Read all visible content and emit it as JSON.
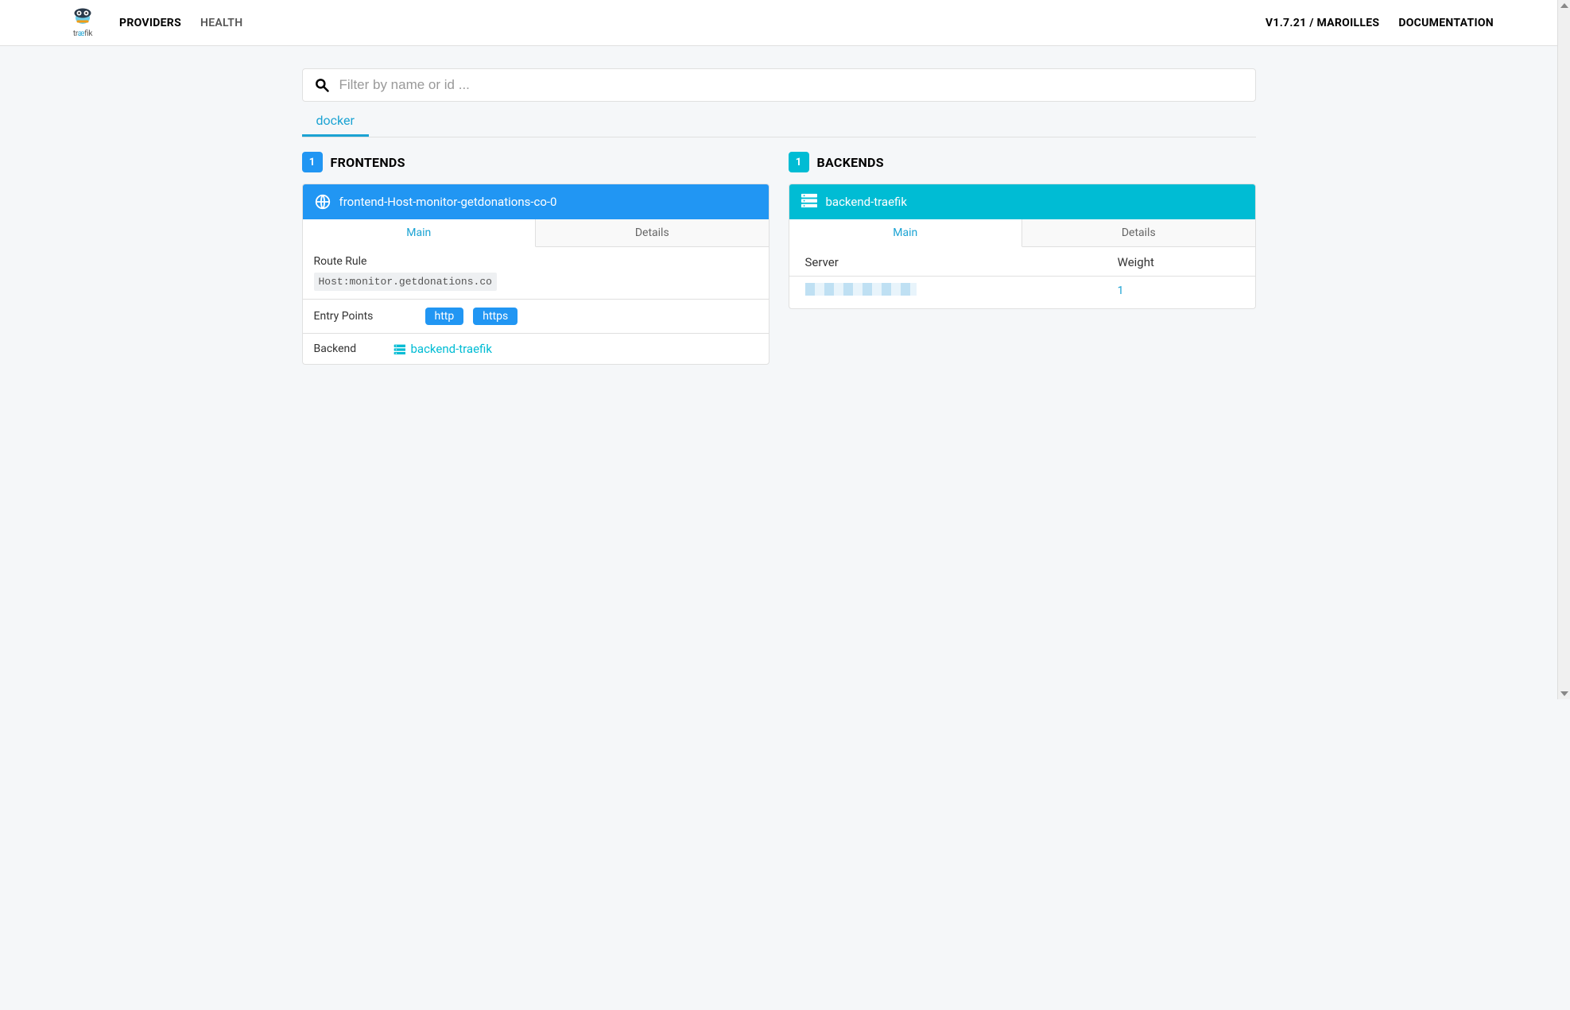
{
  "nav": {
    "logo_text_left": "tr",
    "logo_text_mid": "æ",
    "logo_text_right": "fik",
    "items": [
      "PROVIDERS",
      "HEALTH"
    ],
    "active_index": 0,
    "right": {
      "version": "V1.7.21 / MAROILLES",
      "docs": "DOCUMENTATION"
    }
  },
  "search": {
    "placeholder": "Filter by name or id ..."
  },
  "provider_tabs": {
    "items": [
      "docker"
    ],
    "active_index": 0
  },
  "frontends": {
    "title": "FRONTENDS",
    "count": "1",
    "items": [
      {
        "name": "frontend-Host-monitor-getdonations-co-0",
        "tabs": {
          "items": [
            "Main",
            "Details"
          ],
          "active_index": 0
        },
        "route_rule_label": "Route Rule",
        "route_rule_value": "Host:monitor.getdonations.co",
        "entry_points_label": "Entry Points",
        "entry_points": [
          "http",
          "https"
        ],
        "backend_label": "Backend",
        "backend_link": "backend-traefik"
      }
    ]
  },
  "backends": {
    "title": "BACKENDS",
    "count": "1",
    "items": [
      {
        "name": "backend-traefik",
        "tabs": {
          "items": [
            "Main",
            "Details"
          ],
          "active_index": 0
        },
        "server_col": "Server",
        "weight_col": "Weight",
        "rows": [
          {
            "weight": "1"
          }
        ]
      }
    ]
  }
}
